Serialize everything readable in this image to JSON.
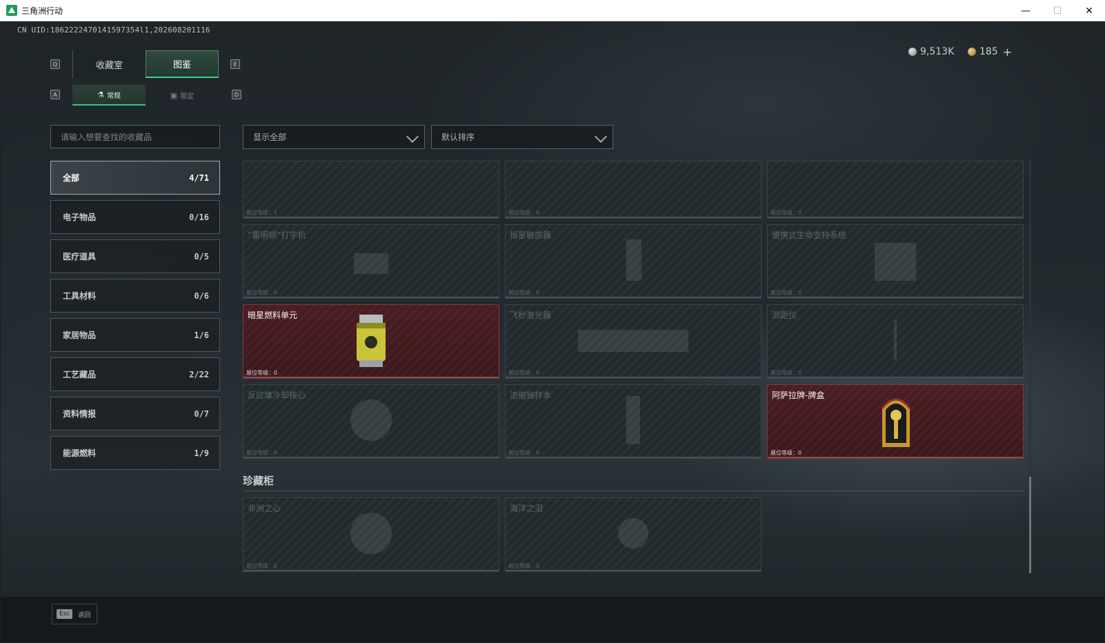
{
  "window": {
    "title": "三角洲行动"
  },
  "uid": "CN UID:1862222470141597354l1,202608201116",
  "currency": {
    "silver": "9,513K",
    "gold": "185",
    "plus": "+"
  },
  "keys": {
    "q": "Q",
    "e": "E",
    "a": "A",
    "d": "D"
  },
  "tabs": [
    {
      "label": "收藏室"
    },
    {
      "label": "图鉴"
    }
  ],
  "subtabs": [
    {
      "label": "常规",
      "icon": "flask-icon"
    },
    {
      "label": "限定",
      "icon": "picture-icon"
    }
  ],
  "search": {
    "placeholder": "请输入想要查找的收藏品"
  },
  "filters": {
    "show": "显示全部",
    "sort": "默认排序"
  },
  "categories": [
    {
      "label": "全部",
      "count": "4/71"
    },
    {
      "label": "电子物品",
      "count": "0/16"
    },
    {
      "label": "医疗道具",
      "count": "0/5"
    },
    {
      "label": "工具材料",
      "count": "0/6"
    },
    {
      "label": "家居物品",
      "count": "1/6"
    },
    {
      "label": "工艺藏品",
      "count": "2/22"
    },
    {
      "label": "资料情报",
      "count": "0/7"
    },
    {
      "label": "能源燃料",
      "count": "1/9"
    }
  ],
  "level_label": "展位等级：",
  "cards": [
    {
      "name": "",
      "level": "1",
      "owned": false
    },
    {
      "name": "",
      "level": "0",
      "owned": false
    },
    {
      "name": "",
      "level": "0",
      "owned": false
    },
    {
      "name": "“雷明顿”打字机",
      "level": "0",
      "owned": false
    },
    {
      "name": "恒星敏感器",
      "level": "0",
      "owned": false
    },
    {
      "name": "便携式生命支持系统",
      "level": "0",
      "owned": false
    },
    {
      "name": "暗星燃料单元",
      "level": "0",
      "owned": true
    },
    {
      "name": "飞秒激光器",
      "level": "0",
      "owned": false
    },
    {
      "name": "测距仪",
      "level": "0",
      "owned": false
    },
    {
      "name": "反应堆冷却核心",
      "level": "0",
      "owned": false
    },
    {
      "name": "浓缩铀样本",
      "level": "0",
      "owned": false
    },
    {
      "name": "阿萨拉牌-牌盒",
      "level": "0",
      "owned": true
    }
  ],
  "treasure": {
    "title": "珍藏柜",
    "cards": [
      {
        "name": "非洲之心",
        "level": "0"
      },
      {
        "name": "海洋之泪",
        "level": "0"
      }
    ]
  },
  "footer": {
    "key": "Esc",
    "label": "返回"
  }
}
